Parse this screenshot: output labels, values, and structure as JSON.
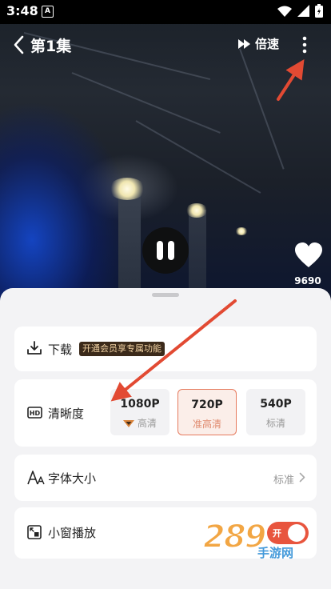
{
  "status_bar": {
    "time": "3:48",
    "app_badge": "A"
  },
  "top_bar": {
    "title": "第1集",
    "speed_label": "倍速"
  },
  "video": {
    "like_count": "9690"
  },
  "sheet": {
    "download": {
      "label": "下载",
      "vip_badge": "开通会员享专属功能"
    },
    "quality": {
      "label": "清晰度",
      "options": [
        {
          "value": "1080P",
          "desc": "高清",
          "vip": true
        },
        {
          "value": "720P",
          "desc": "准高清",
          "selected": true
        },
        {
          "value": "540P",
          "desc": "标清"
        }
      ]
    },
    "font_size": {
      "label": "字体大小",
      "value": "标准"
    },
    "mini_window": {
      "label": "小窗播放",
      "toggle_text": "开",
      "enabled": true
    }
  },
  "watermark": {
    "number": "289",
    "text": "手游网"
  },
  "colors": {
    "accent": "#e8553e",
    "selected_bg": "#fbeee9",
    "vip_badge_bg": "#3b2a1a",
    "arrow": "#e24a33"
  }
}
